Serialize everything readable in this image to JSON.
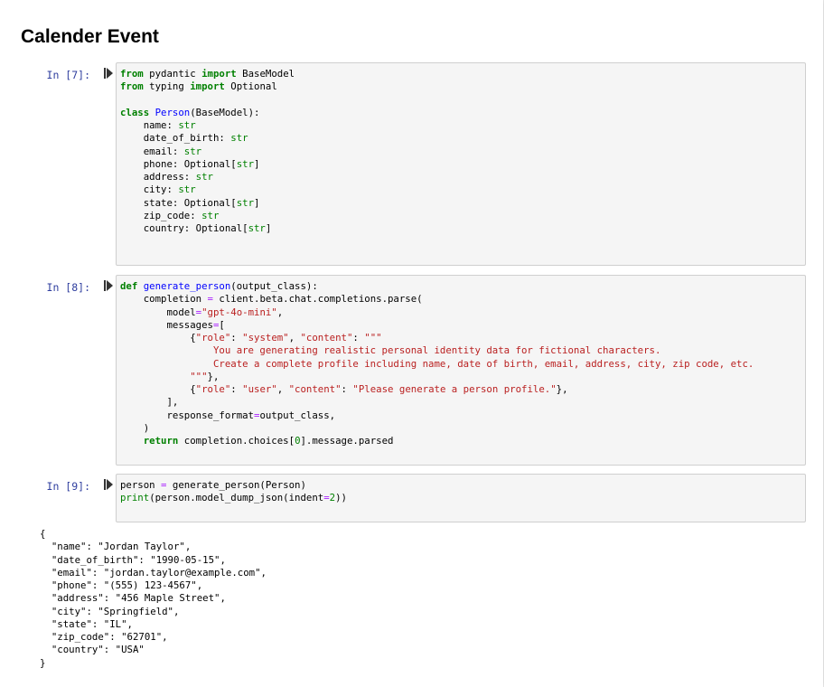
{
  "notebook": {
    "title": "Calender Event"
  },
  "cells": [
    {
      "prompt": "In [7]:",
      "lines": [
        [
          [
            "kw",
            "from"
          ],
          [
            "",
            "pydantic"
          ],
          [
            "kw",
            "import"
          ],
          [
            "",
            "BaseModel"
          ]
        ],
        [
          [
            "kw",
            "from"
          ],
          [
            "",
            "typing"
          ],
          [
            "kw",
            "import"
          ],
          [
            "",
            "Optional"
          ]
        ],
        [],
        [
          [
            "kw",
            "class"
          ],
          [
            "fn",
            "Person"
          ],
          [
            "",
            "(BaseModel):"
          ]
        ],
        [
          [
            "",
            "    name: "
          ],
          [
            "bi",
            "str"
          ]
        ],
        [
          [
            "",
            "    date_of_birth: "
          ],
          [
            "bi",
            "str"
          ]
        ],
        [
          [
            "",
            "    email: "
          ],
          [
            "bi",
            "str"
          ]
        ],
        [
          [
            "",
            "    phone: Optional["
          ],
          [
            "bi",
            "str"
          ],
          [
            "",
            "]"
          ]
        ],
        [
          [
            "",
            "    address: "
          ],
          [
            "bi",
            "str"
          ]
        ],
        [
          [
            "",
            "    city: "
          ],
          [
            "bi",
            "str"
          ]
        ],
        [
          [
            "",
            "    state: Optional["
          ],
          [
            "bi",
            "str"
          ],
          [
            "",
            "]"
          ]
        ],
        [
          [
            "",
            "    zip_code: "
          ],
          [
            "bi",
            "str"
          ]
        ],
        [
          [
            "",
            "    country: Optional["
          ],
          [
            "bi",
            "str"
          ],
          [
            "",
            "]"
          ]
        ]
      ]
    },
    {
      "prompt": "In [8]:",
      "lines": [
        [
          [
            "kw",
            "def"
          ],
          [
            "fn",
            "generate_person"
          ],
          [
            "",
            "(output_class):"
          ]
        ],
        [
          [
            "",
            "    completion "
          ],
          [
            "op",
            "="
          ],
          [
            "",
            " client.beta.chat.completions.parse("
          ]
        ],
        [
          [
            "",
            "        model"
          ],
          [
            "op",
            "="
          ],
          [
            "st",
            "\"gpt-4o-mini\""
          ],
          [
            "",
            ","
          ]
        ],
        [
          [
            "",
            "        messages"
          ],
          [
            "op",
            "="
          ],
          [
            "",
            "["
          ]
        ],
        [
          [
            "",
            "            {"
          ],
          [
            "st",
            "\"role\""
          ],
          [
            "",
            ": "
          ],
          [
            "st",
            "\"system\""
          ],
          [
            "",
            ", "
          ],
          [
            "st",
            "\"content\""
          ],
          [
            "",
            ": "
          ],
          [
            "st",
            "\"\"\""
          ]
        ],
        [
          [
            "st",
            "                You are generating realistic personal identity data for fictional characters."
          ]
        ],
        [
          [
            "st",
            "                Create a complete profile including name, date of birth, email, address, city, zip code, etc."
          ]
        ],
        [
          [
            "st",
            "            \"\"\""
          ],
          [
            "",
            "},"
          ]
        ],
        [
          [
            "",
            "            {"
          ],
          [
            "st",
            "\"role\""
          ],
          [
            "",
            ": "
          ],
          [
            "st",
            "\"user\""
          ],
          [
            "",
            ", "
          ],
          [
            "st",
            "\"content\""
          ],
          [
            "",
            ": "
          ],
          [
            "st",
            "\"Please generate a person profile.\""
          ],
          [
            "",
            "},"
          ]
        ],
        [
          [
            "",
            "        ],"
          ]
        ],
        [
          [
            "",
            "        response_format"
          ],
          [
            "op",
            "="
          ],
          [
            "",
            "output_class,"
          ]
        ],
        [
          [
            "",
            "    )"
          ]
        ],
        [
          [
            "",
            "    "
          ],
          [
            "kw",
            "return"
          ],
          [
            "",
            " completion.choices["
          ],
          [
            "nm",
            "0"
          ],
          [
            "",
            "].message.parsed"
          ]
        ]
      ]
    },
    {
      "prompt": "In [9]:",
      "lines": [
        [
          [
            "",
            "person "
          ],
          [
            "op",
            "="
          ],
          [
            "",
            " generate_person(Person)"
          ]
        ],
        [
          [
            "bi",
            "print"
          ],
          [
            "",
            "(person.model_dump_json(indent"
          ],
          [
            "op",
            "="
          ],
          [
            "nm",
            "2"
          ],
          [
            "",
            "))"
          ]
        ]
      ]
    }
  ],
  "output": {
    "text": "{\n  \"name\": \"Jordan Taylor\",\n  \"date_of_birth\": \"1990-05-15\",\n  \"email\": \"jordan.taylor@example.com\",\n  \"phone\": \"(555) 123-4567\",\n  \"address\": \"456 Maple Street\",\n  \"city\": \"Springfield\",\n  \"state\": \"IL\",\n  \"zip_code\": \"62701\",\n  \"country\": \"USA\"\n}"
  },
  "colors": {
    "keyword": "#008000",
    "def_name": "#0000ff",
    "string": "#ba2121",
    "operator": "#aa22ff",
    "prompt": "#303f9f",
    "cell_background": "#f5f5f5"
  },
  "icons": {
    "run": "run-cell-icon"
  }
}
